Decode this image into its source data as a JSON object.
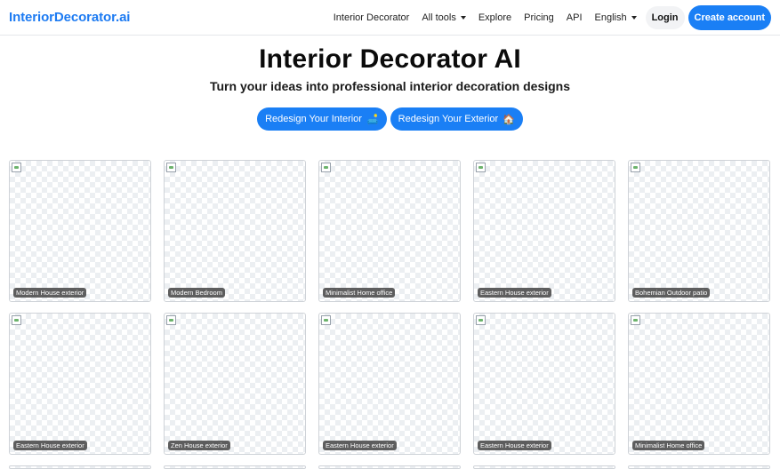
{
  "nav": {
    "brand": "InteriorDecorator.ai",
    "links": [
      {
        "label": "Interior Decorator",
        "dropdown": false
      },
      {
        "label": "All tools",
        "dropdown": true
      },
      {
        "label": "Explore",
        "dropdown": false
      },
      {
        "label": "Pricing",
        "dropdown": false
      },
      {
        "label": "API",
        "dropdown": false
      },
      {
        "label": "English",
        "dropdown": true
      }
    ],
    "login": "Login",
    "create_account": "Create account"
  },
  "hero": {
    "title": "Interior Decorator AI",
    "subtitle": "Turn your ideas into professional interior decoration designs",
    "cta_interior": "Redesign Your Interior",
    "cta_interior_emoji": "🛋️",
    "cta_exterior": "Redesign Your Exterior",
    "cta_exterior_emoji": "🏠"
  },
  "gallery": [
    "Modern House exterior",
    "Modern Bedroom",
    "Minimalist Home office",
    "Eastern House exterior",
    "Bohemian Outdoor patio",
    "Eastern House exterior",
    "Zen House exterior",
    "Eastern House exterior",
    "Eastern House exterior",
    "Minimalist Home office"
  ],
  "colors": {
    "accent": "#1a7ff5",
    "brand": "#1d7bf2"
  }
}
